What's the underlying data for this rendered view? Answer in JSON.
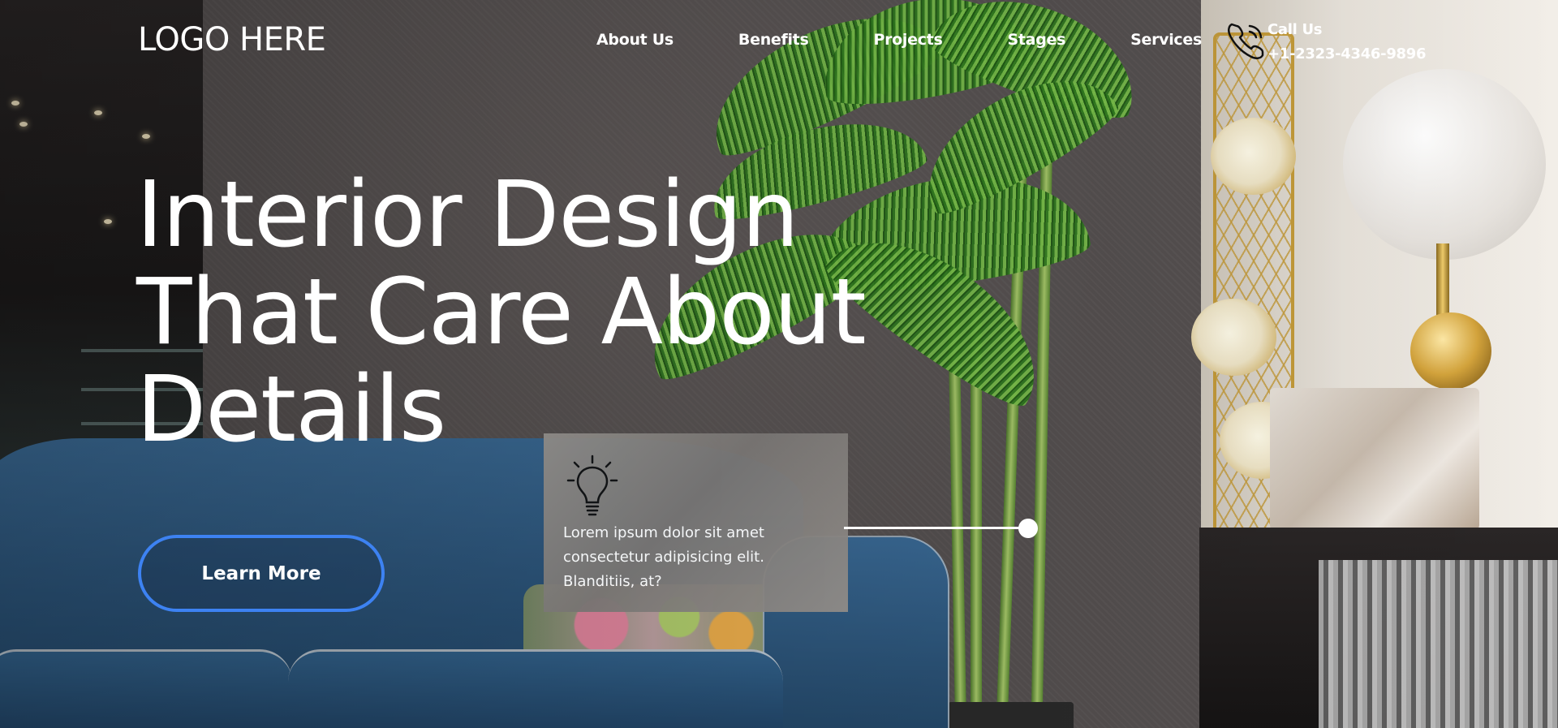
{
  "header": {
    "logo": "LOGO HERE",
    "nav": [
      "About Us",
      "Benefits",
      "Projects",
      "Stages",
      "Services"
    ],
    "call_label": "Call Us",
    "phone": "+1-2323-4346-9896",
    "phone_icon": "phone-icon"
  },
  "hero": {
    "title_lines": [
      "Interior Design",
      "That Care About",
      "Details"
    ],
    "cta_label": "Learn More",
    "cta_border_color": "#3d82f2"
  },
  "card": {
    "icon": "lightbulb-icon",
    "text_lines": [
      "Lorem ipsum dolor sit amet",
      "consectetur adipisicing elit.",
      "Blanditiis, at?"
    ]
  }
}
